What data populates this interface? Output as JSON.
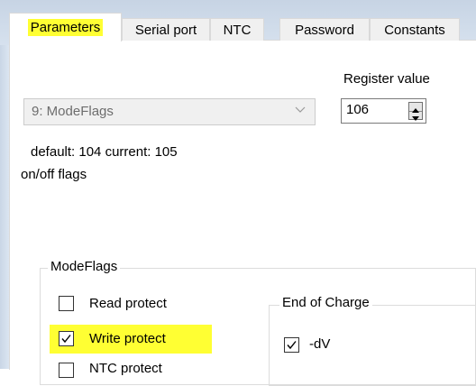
{
  "tabs": [
    {
      "label": "Parameters",
      "active": true,
      "highlighted": true
    },
    {
      "label": "Serial port",
      "active": false
    },
    {
      "label": "NTC",
      "active": false
    },
    {
      "label": "Password",
      "active": false
    },
    {
      "label": "Constants",
      "active": false
    }
  ],
  "parameter": {
    "selected": "9: ModeFlags",
    "defaults_line": "default: 104 current: 105",
    "description": "on/off flags"
  },
  "register": {
    "label": "Register value",
    "value": "106"
  },
  "modeflags_group": {
    "title": "ModeFlags",
    "checkboxes": [
      {
        "label": "Read protect",
        "checked": false
      },
      {
        "label": "Write protect",
        "checked": true,
        "highlighted": true
      },
      {
        "label": "NTC protect",
        "checked": false
      }
    ]
  },
  "end_of_charge_group": {
    "title": "End of Charge",
    "checkboxes": [
      {
        "label": "-dV",
        "checked": true
      }
    ]
  },
  "colors": {
    "highlight": "#ffff33",
    "window_bg": "#d6e1ee",
    "tab_bg": "#f0f0f0"
  }
}
